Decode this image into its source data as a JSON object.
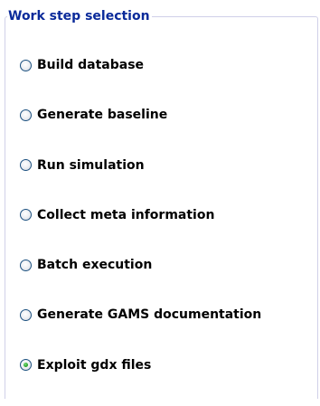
{
  "group": {
    "title": "Work step selection"
  },
  "options": [
    {
      "label": "Build database",
      "checked": false
    },
    {
      "label": "Generate baseline",
      "checked": false
    },
    {
      "label": "Run simulation",
      "checked": false
    },
    {
      "label": "Collect meta information",
      "checked": false
    },
    {
      "label": "Batch execution",
      "checked": false
    },
    {
      "label": "Generate GAMS documentation",
      "checked": false
    },
    {
      "label": "Exploit gdx files",
      "checked": true
    }
  ],
  "colors": {
    "legend_text": "#0a2a9a",
    "group_border": "#d0d0e8",
    "radio_border": "#1c5180",
    "radio_checked_dot": "#2ca52c"
  }
}
